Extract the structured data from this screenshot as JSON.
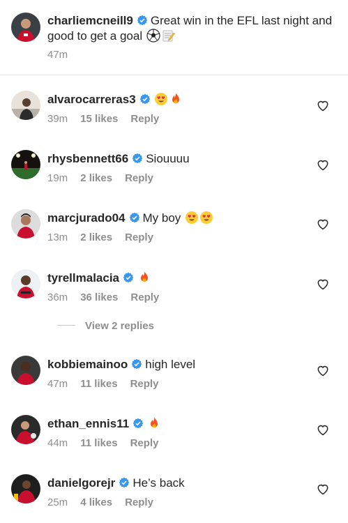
{
  "post": {
    "username": "charliemcneill9",
    "caption": "Great win in the EFL last night and good to get a goal",
    "caption_emojis": [
      "soccer-ball-emoji",
      "memo-emoji"
    ],
    "time": "47m"
  },
  "comments": [
    {
      "username": "alvarocarreras3",
      "text": "",
      "emojis": [
        "heart-eyes-emoji",
        "fire-emoji"
      ],
      "time": "39m",
      "likes": "15 likes",
      "reply": "Reply"
    },
    {
      "username": "rhysbennett66",
      "text": "Siouuuu",
      "emojis": [],
      "time": "19m",
      "likes": "2 likes",
      "reply": "Reply"
    },
    {
      "username": "marcjurado04",
      "text": "My boy",
      "emojis": [
        "heart-eyes-emoji",
        "heart-eyes-emoji"
      ],
      "time": "13m",
      "likes": "2 likes",
      "reply": "Reply"
    },
    {
      "username": "tyrellmalacia",
      "text": "",
      "emojis": [
        "fire-emoji"
      ],
      "time": "36m",
      "likes": "36 likes",
      "reply": "Reply"
    },
    {
      "username": "kobbiemainoo",
      "text": "high level",
      "emojis": [],
      "time": "47m",
      "likes": "11 likes",
      "reply": "Reply"
    },
    {
      "username": "ethan_ennis11",
      "text": "",
      "emojis": [
        "fire-emoji"
      ],
      "time": "44m",
      "likes": "11 likes",
      "reply": "Reply"
    },
    {
      "username": "danielgorejr",
      "text": "He’s back",
      "emojis": [],
      "time": "25m",
      "likes": "4 likes",
      "reply": "Reply"
    }
  ],
  "view_replies": "View 2 replies",
  "colors": {
    "verified": "#3897f0",
    "secondary_text": "#8e8e8e",
    "primary_text": "#262626"
  }
}
